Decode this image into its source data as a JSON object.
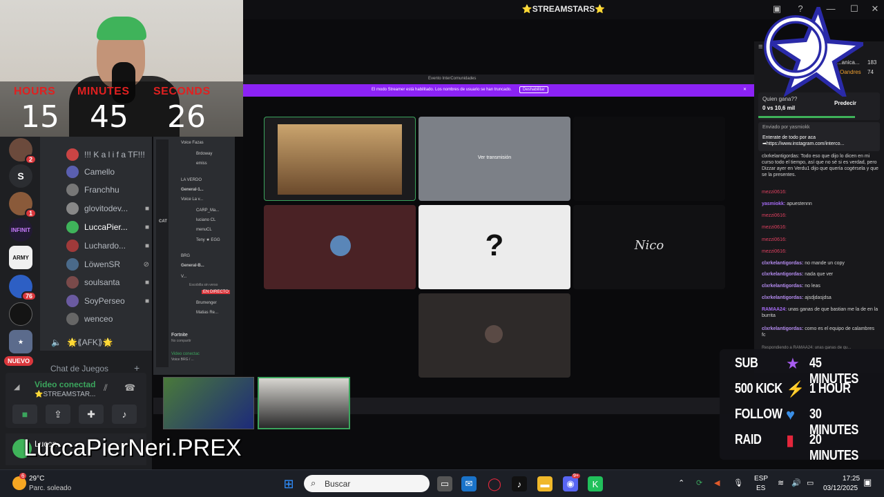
{
  "window": {
    "title": "⭐STREAMSTARS⭐"
  },
  "timer": {
    "labels": [
      "HOURS",
      "MINUTES",
      "SECONDS"
    ],
    "values": [
      "15",
      "45",
      "26"
    ]
  },
  "guilds": [
    {
      "label": "",
      "badge": "2"
    },
    {
      "label": "S",
      "badge": ""
    },
    {
      "label": "",
      "badge": "1"
    },
    {
      "label": "INFINIT",
      "badge": ""
    },
    {
      "label": "ARMY",
      "badge": ""
    },
    {
      "label": "",
      "badge": "76"
    },
    {
      "label": "",
      "badge": ""
    },
    {
      "label": "",
      "badge": ""
    }
  ],
  "guild_new": "NUEVO",
  "voice_members": [
    "!!! K a l i f a TF!!!",
    "Camello",
    "Franchhu",
    "glovitodev...",
    "LuccaPier...",
    "Luchardo...",
    "LöwenSR",
    "soulsanta",
    "SoyPerseo",
    "wenceo"
  ],
  "afk_channel": "🌟⟪AFK⟫🌟",
  "games_chat": "Chat de Juegos",
  "voice_panel": {
    "status": "Video conectad",
    "channel": "⭐STREAMSTAR..."
  },
  "user": {
    "name": "Lucca"
  },
  "overlay_name": "LuccaPierNeri.PREX",
  "server_rows": [
    "Voice Fazas",
    "Brdoway",
    "emiss",
    "LA VERDO",
    "General-1...",
    "Voice La v...",
    "CARP_Ma...",
    "luciano CL",
    "menuCL",
    "Teny ★ EGG",
    "CAT",
    "BRG",
    "General-B...",
    "V...",
    "Escobilla sin verso",
    "EN DIRECTO",
    "Brumenger",
    "Matias Re..."
  ],
  "server_fortnite": {
    "name": "Fortnite",
    "sub": "No compartir"
  },
  "server_video": {
    "name": "Video conectac",
    "sub": "Voice BRG / ..."
  },
  "share": {
    "window_title": "Evento InterComunidades",
    "banner": "El modo Streamer está habilitado. Los nombres de usuario se han truncado.",
    "banner_button": "Deshabilitar",
    "tile_label": "Ver transmisión",
    "question": "?",
    "signature": "Nico"
  },
  "chat": {
    "header_names": [
      "...anica...",
      "Oandres"
    ],
    "header_counts": [
      "183",
      "74"
    ],
    "prediction": {
      "question": "Quien gana??",
      "score": "0 vs 10,6 mil",
      "button": "Predecir"
    },
    "pinned": {
      "by": "Enviado por yasmiokk",
      "text": "Enterate de todo por aca ➡https://www.instagram.com/interco..."
    },
    "messages": [
      {
        "user": "",
        "text": "clxrkelantigordas: Todo eso que dijo lo dicen en mi curso todo el tiempo, así que no sé si es verdad, pero Dizzar ayer en Verdu1 dijo que quería cogérsela y que se la presentes."
      },
      {
        "user": "mezzi0616:",
        "text": ""
      },
      {
        "user": "yasmiokk:",
        "text": "apuestennn"
      },
      {
        "user": "mezzi0616:",
        "text": ""
      },
      {
        "user": "mezzi0616:",
        "text": ""
      },
      {
        "user": "mezzi0616:",
        "text": ""
      },
      {
        "user": "mezzi0616:",
        "text": ""
      },
      {
        "user": "clxrkelantigordas:",
        "text": "no mande un copy"
      },
      {
        "user": "clxrkelantigordas:",
        "text": "nada que ver"
      },
      {
        "user": "clxrkelantigordas:",
        "text": "no leas"
      },
      {
        "user": "clxrkelantigordas:",
        "text": "ajsdjdasjdsa"
      },
      {
        "user": "RAMAA24:",
        "text": "unas ganas de que bastian me la de en la burrita"
      },
      {
        "user": "clxrkelantigordas:",
        "text": "como es el equipo de calambres fc"
      },
      {
        "user": "",
        "text": "Respondiendo a RAMAA24: unas ganas de qu..."
      }
    ]
  },
  "goals": [
    {
      "left": "SUB",
      "icon": "★",
      "right": "45 MINUTES",
      "color": "#a85cf0"
    },
    {
      "left": "500 KICK",
      "icon": "⚡",
      "right": "1 HOUR",
      "color": "#f5c518"
    },
    {
      "left": "FOLLOW",
      "icon": "♥",
      "right": "30 MINUTES",
      "color": "#3a8ee6"
    },
    {
      "left": "RAID",
      "icon": "▮",
      "right": "20 MINUTES",
      "color": "#e3263b"
    }
  ],
  "taskbar": {
    "weather_temp": "29°C",
    "weather_desc": "Parc. soleado",
    "weather_badge": "6",
    "search_placeholder": "Buscar",
    "lang_top": "ESP",
    "lang_bottom": "ES",
    "time": "17:25",
    "date": "03/12/2025",
    "discord_badge": "9+"
  }
}
